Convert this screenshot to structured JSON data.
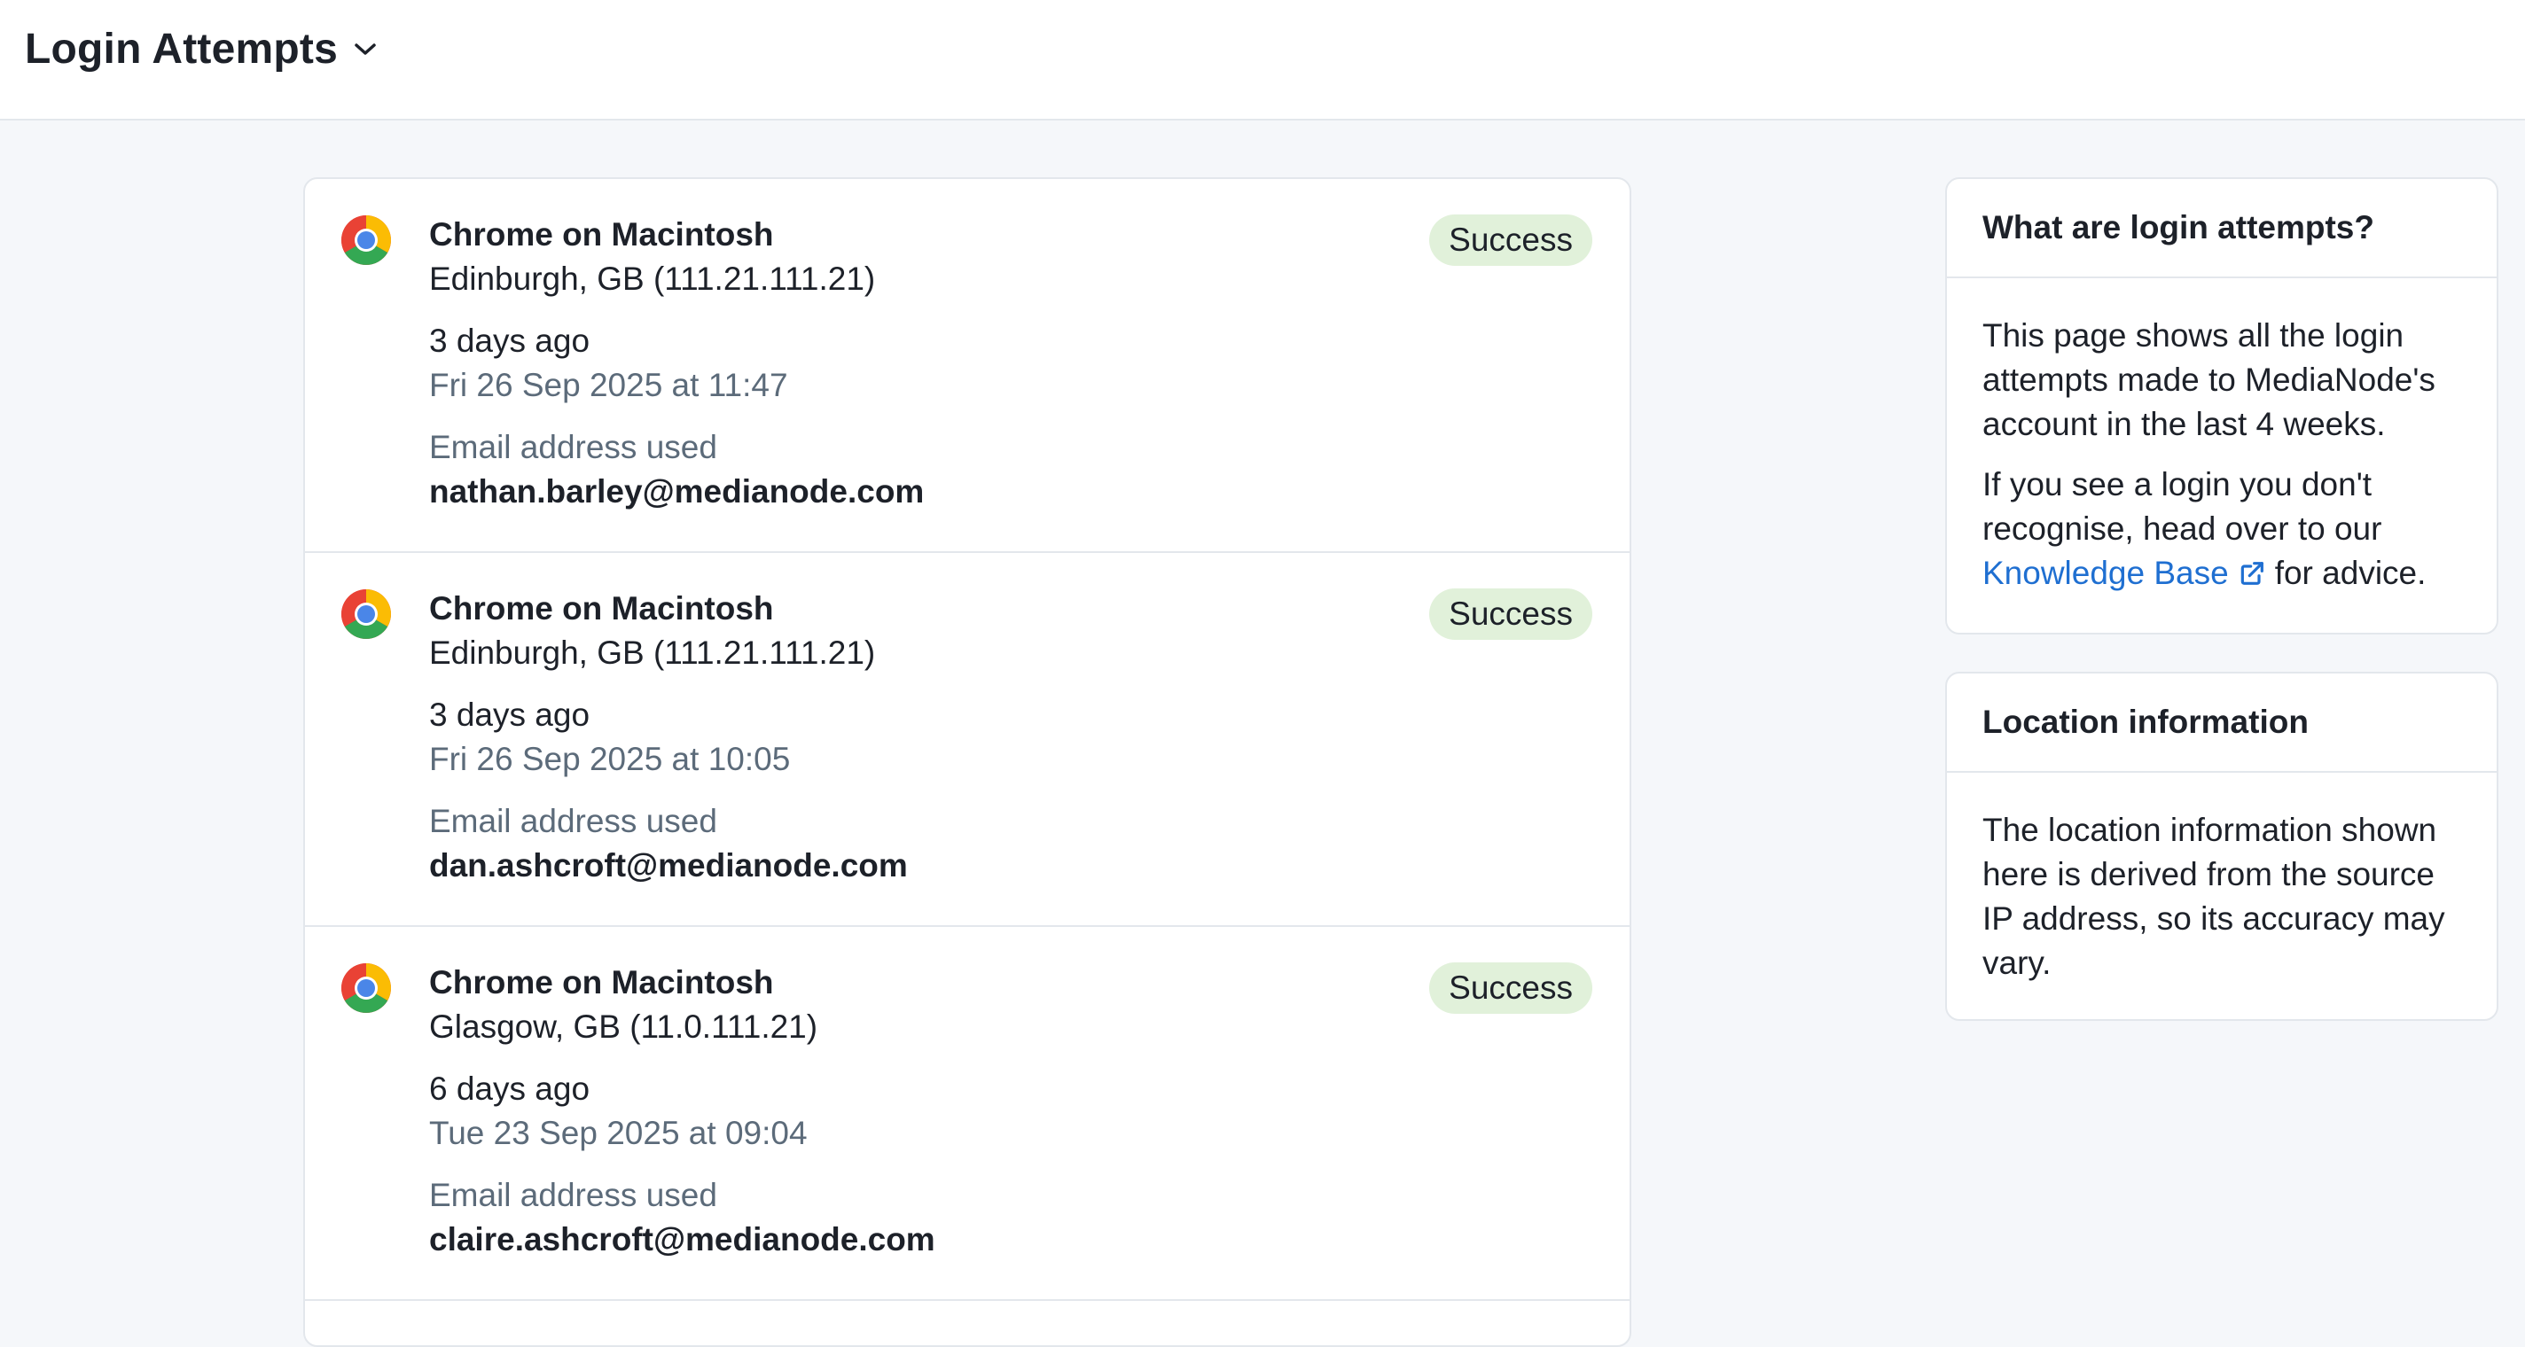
{
  "header": {
    "title": "Login Attempts"
  },
  "attempts": [
    {
      "browser_icon": "chrome-icon",
      "device": "Chrome on Macintosh",
      "location": "Edinburgh, GB (111.21.111.21)",
      "relative_time": "3 days ago",
      "timestamp": "Fri 26 Sep 2025 at 11:47",
      "email_label": "Email address used",
      "email": "nathan.barley@medianode.com",
      "status": "Success"
    },
    {
      "browser_icon": "chrome-icon",
      "device": "Chrome on Macintosh",
      "location": "Edinburgh, GB (111.21.111.21)",
      "relative_time": "3 days ago",
      "timestamp": "Fri 26 Sep 2025 at 10:05",
      "email_label": "Email address used",
      "email": "dan.ashcroft@medianode.com",
      "status": "Success"
    },
    {
      "browser_icon": "chrome-icon",
      "device": "Chrome on Macintosh",
      "location": "Glasgow, GB (11.0.111.21)",
      "relative_time": "6 days ago",
      "timestamp": "Tue 23 Sep 2025 at 09:04",
      "email_label": "Email address used",
      "email": "claire.ashcroft@medianode.com",
      "status": "Success"
    }
  ],
  "help_panel": {
    "title": "What are login attempts?",
    "paragraph1": "This page shows all the login attempts made to MediaNode's account in the last 4 weeks.",
    "paragraph2_before": "If you see a login you don't recognise, head over to our",
    "link_text": "Knowledge Base",
    "link_icon": "external-link-icon",
    "paragraph2_after": "for advice."
  },
  "location_panel": {
    "title": "Location information",
    "body": "The location information shown here is derived from the source IP address, so its accuracy may vary."
  },
  "colors": {
    "success_badge_bg": "#e1f1da",
    "link": "#1f6fd1",
    "muted_text": "#5c6b7a",
    "page_bg": "#f5f7fa"
  }
}
